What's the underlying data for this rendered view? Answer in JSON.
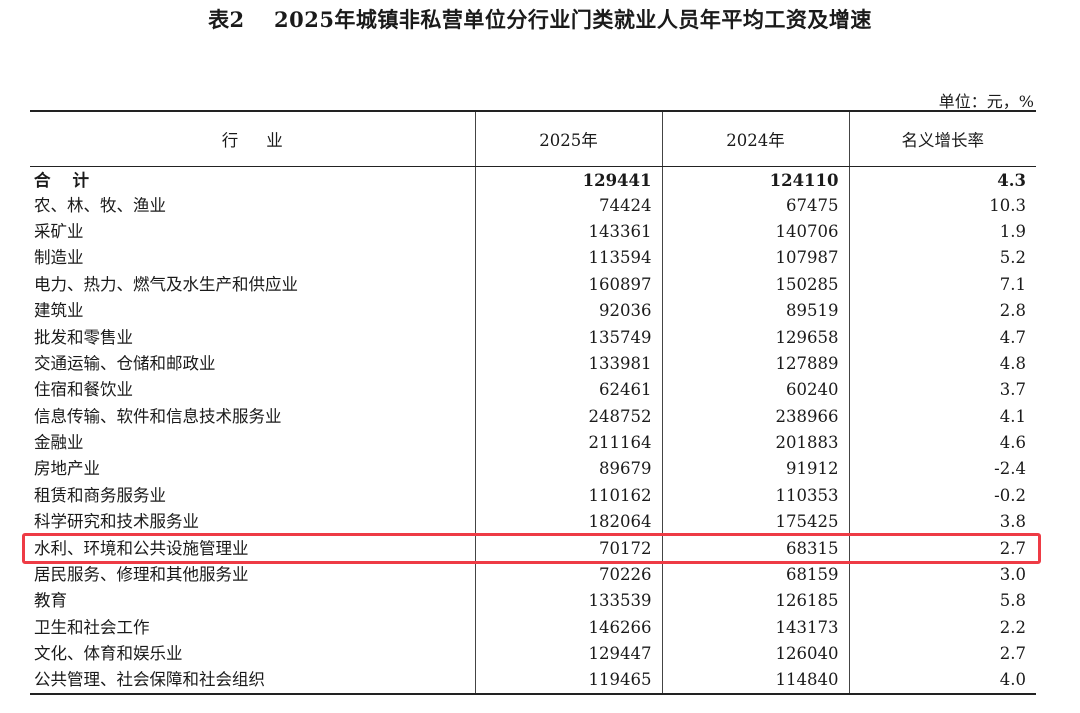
{
  "title": "表2　 2025年城镇非私营单位分行业门类就业人员年平均工资及增速",
  "unit": "单位：元，%",
  "table": {
    "headers": [
      "行业",
      "2025年",
      "2024年",
      "名义增长率"
    ],
    "rows": [
      {
        "industry": "合计",
        "y2025": "129441",
        "y2024": "124110",
        "rate": "4.3"
      },
      {
        "industry": "农、林、牧、渔业",
        "y2025": "74424",
        "y2024": "67475",
        "rate": "10.3"
      },
      {
        "industry": "采矿业",
        "y2025": "143361",
        "y2024": "140706",
        "rate": "1.9"
      },
      {
        "industry": "制造业",
        "y2025": "113594",
        "y2024": "107987",
        "rate": "5.2"
      },
      {
        "industry": "电力、热力、燃气及水生产和供应业",
        "y2025": "160897",
        "y2024": "150285",
        "rate": "7.1"
      },
      {
        "industry": "建筑业",
        "y2025": "92036",
        "y2024": "89519",
        "rate": "2.8"
      },
      {
        "industry": "批发和零售业",
        "y2025": "135749",
        "y2024": "129658",
        "rate": "4.7"
      },
      {
        "industry": "交通运输、仓储和邮政业",
        "y2025": "133981",
        "y2024": "127889",
        "rate": "4.8"
      },
      {
        "industry": "住宿和餐饮业",
        "y2025": "62461",
        "y2024": "60240",
        "rate": "3.7"
      },
      {
        "industry": "信息传输、软件和信息技术服务业",
        "y2025": "248752",
        "y2024": "238966",
        "rate": "4.1"
      },
      {
        "industry": "金融业",
        "y2025": "211164",
        "y2024": "201883",
        "rate": "4.6"
      },
      {
        "industry": "房地产业",
        "y2025": "89679",
        "y2024": "91912",
        "rate": "-2.4"
      },
      {
        "industry": "租赁和商务服务业",
        "y2025": "110162",
        "y2024": "110353",
        "rate": "-0.2"
      },
      {
        "industry": "科学研究和技术服务业",
        "y2025": "182064",
        "y2024": "175425",
        "rate": "3.8"
      },
      {
        "industry": "水利、环境和公共设施管理业",
        "y2025": "70172",
        "y2024": "68315",
        "rate": "2.7"
      },
      {
        "industry": "居民服务、修理和其他服务业",
        "y2025": "70226",
        "y2024": "68159",
        "rate": "3.0"
      },
      {
        "industry": "教育",
        "y2025": "133539",
        "y2024": "126185",
        "rate": "5.8"
      },
      {
        "industry": "卫生和社会工作",
        "y2025": "146266",
        "y2024": "143173",
        "rate": "2.2"
      },
      {
        "industry": "文化、体育和娱乐业",
        "y2025": "129447",
        "y2024": "126040",
        "rate": "2.7"
      },
      {
        "industry": "公共管理、社会保障和社会组织",
        "y2025": "119465",
        "y2024": "114840",
        "rate": "4.0"
      }
    ]
  },
  "colors": {
    "highlight": "#ee3b45",
    "text": "#1a1a1a",
    "rule": "#222222"
  }
}
